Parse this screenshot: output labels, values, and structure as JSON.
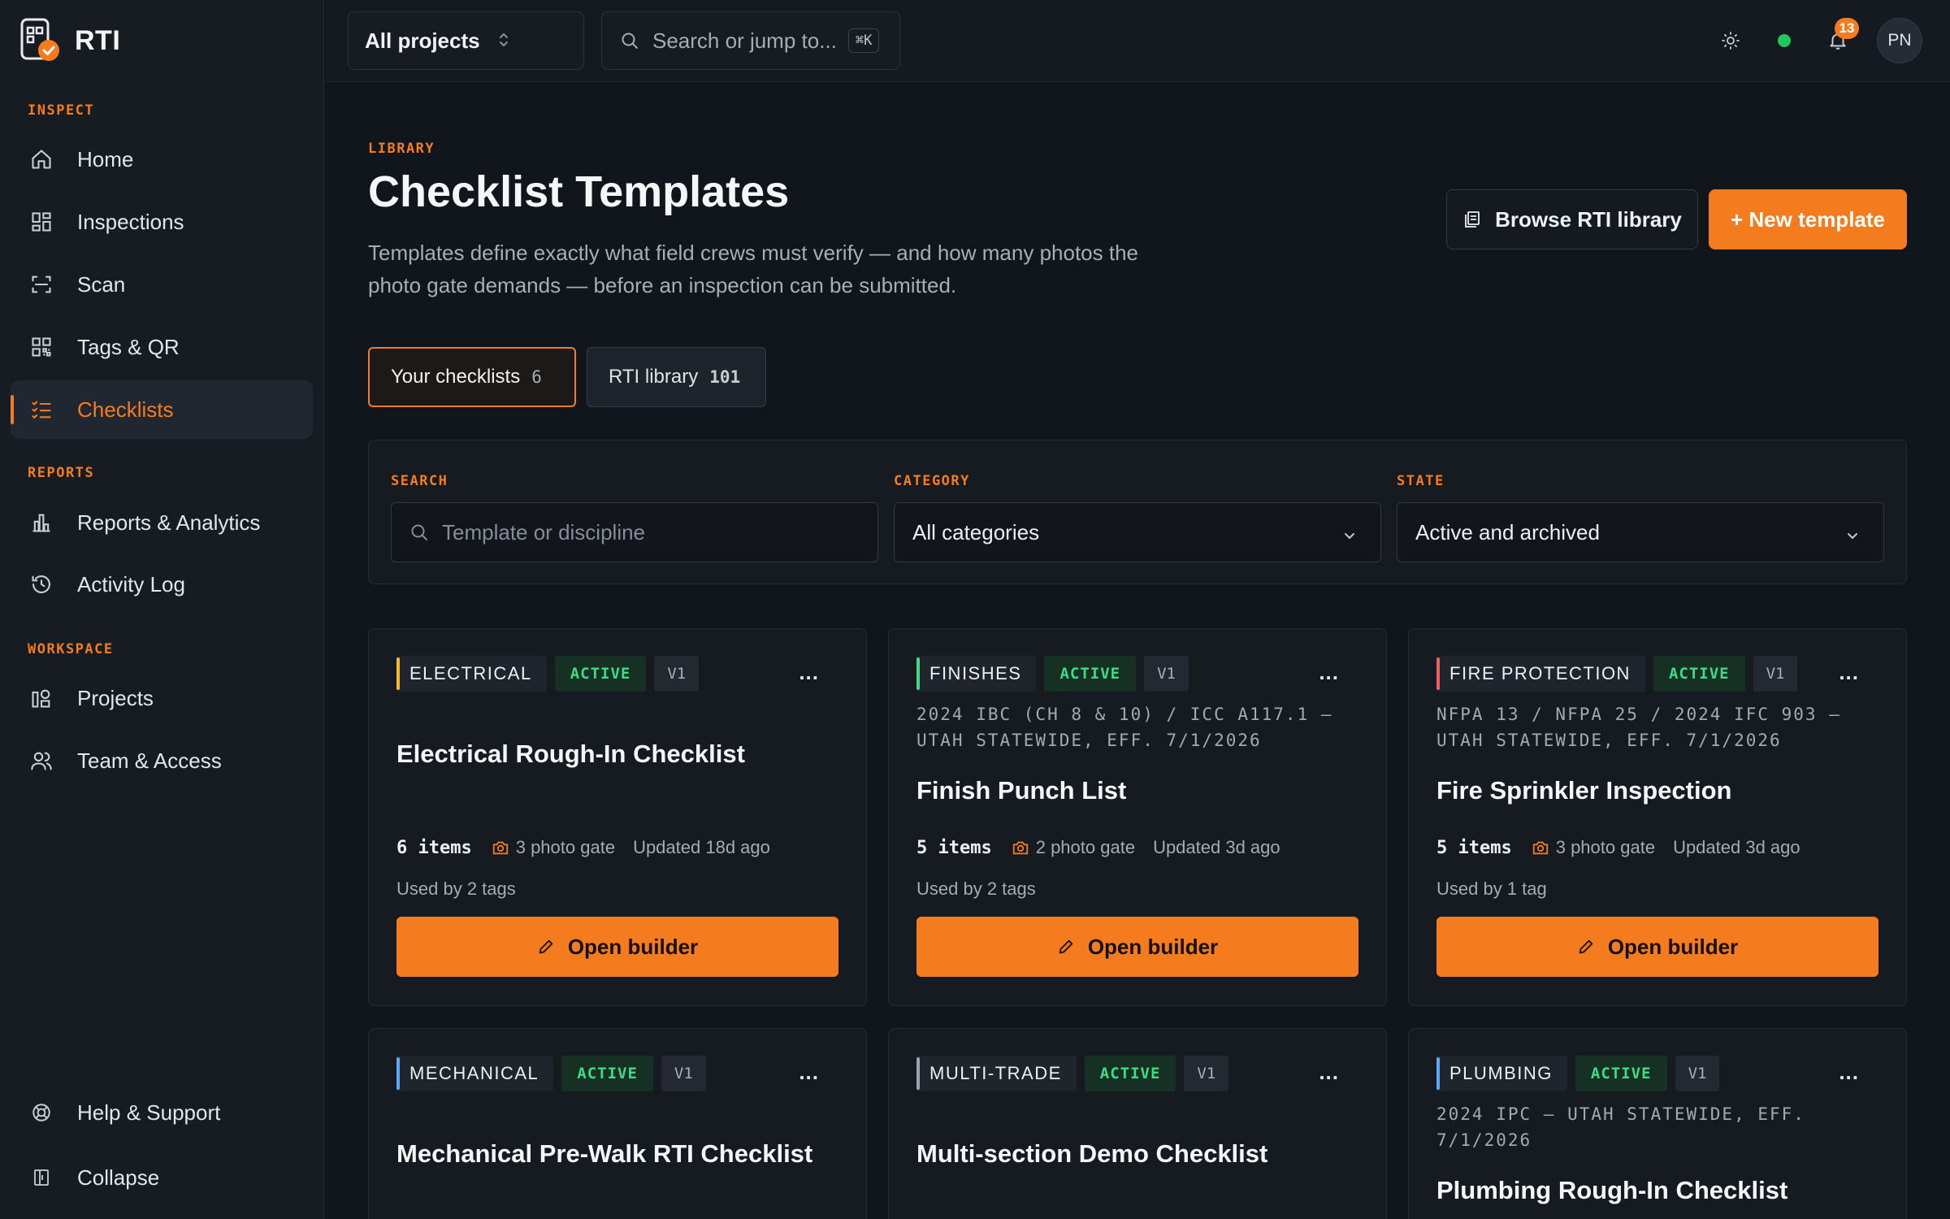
{
  "brand": {
    "name": "RTI"
  },
  "sidebar": {
    "sections": [
      {
        "label": "INSPECT"
      },
      {
        "label": "REPORTS"
      },
      {
        "label": "WORKSPACE"
      }
    ],
    "items": [
      {
        "label": "Home",
        "icon": "home-icon"
      },
      {
        "label": "Inspections",
        "icon": "grid-icon"
      },
      {
        "label": "Scan",
        "icon": "scan-icon"
      },
      {
        "label": "Tags & QR",
        "icon": "qr-icon"
      },
      {
        "label": "Checklists",
        "icon": "checklist-icon",
        "active": true
      },
      {
        "label": "Reports & Analytics",
        "icon": "bar-chart-icon"
      },
      {
        "label": "Activity Log",
        "icon": "history-icon"
      },
      {
        "label": "Projects",
        "icon": "projects-icon"
      },
      {
        "label": "Team & Access",
        "icon": "users-icon"
      }
    ],
    "bottom": [
      {
        "label": "Help & Support",
        "icon": "lifebuoy-icon"
      },
      {
        "label": "Collapse",
        "icon": "collapse-icon"
      }
    ]
  },
  "topbar": {
    "project_select": "All projects",
    "search_placeholder": "Search or jump to...",
    "search_shortcut": "⌘K",
    "notification_count": "13",
    "avatar_initials": "PN"
  },
  "page": {
    "eyebrow": "LIBRARY",
    "title": "Checklist Templates",
    "description": "Templates define exactly what field crews must verify — and how many photos the photo gate demands — before an inspection can be submitted.",
    "browse_button": "Browse RTI library",
    "new_button": "+ New template"
  },
  "tabs": [
    {
      "label": "Your checklists",
      "count": "6"
    },
    {
      "label": "RTI library",
      "count": "101"
    }
  ],
  "filters": {
    "search_label": "SEARCH",
    "search_placeholder": "Template or discipline",
    "category_label": "CATEGORY",
    "category_value": "All categories",
    "state_label": "STATE",
    "state_value": "Active and archived"
  },
  "cards": [
    {
      "category": "ELECTRICAL",
      "accent": "#f5b82e",
      "status": "ACTIVE",
      "version": "V1",
      "code": "",
      "title": "Electrical Rough-In Checklist",
      "items": "6 items",
      "photo_gate": "3 photo gate",
      "updated": "Updated 18d ago",
      "used_by": "Used by 2 tags",
      "button": "Open builder"
    },
    {
      "category": "FINISHES",
      "accent": "#3ddc84",
      "status": "ACTIVE",
      "version": "V1",
      "code": "2024 IBC (CH 8 & 10) / ICC A117.1 — UTAH STATEWIDE, EFF. 7/1/2026",
      "title": "Finish Punch List",
      "items": "5 items",
      "photo_gate": "2 photo gate",
      "updated": "Updated 3d ago",
      "used_by": "Used by 2 tags",
      "button": "Open builder"
    },
    {
      "category": "FIRE PROTECTION",
      "accent": "#f0605a",
      "status": "ACTIVE",
      "version": "V1",
      "code": "NFPA 13 / NFPA 25 / 2024 IFC 903 — UTAH STATEWIDE, EFF. 7/1/2026",
      "title": "Fire Sprinkler Inspection",
      "items": "5 items",
      "photo_gate": "3 photo gate",
      "updated": "Updated 3d ago",
      "used_by": "Used by 1 tag",
      "button": "Open builder"
    },
    {
      "category": "MECHANICAL",
      "accent": "#5aa9f5",
      "status": "ACTIVE",
      "version": "V1",
      "code": "",
      "title": "Mechanical Pre-Walk RTI Checklist"
    },
    {
      "category": "MULTI-TRADE",
      "accent": "#9aa3ae",
      "status": "ACTIVE",
      "version": "V1",
      "code": "",
      "title": "Multi-section Demo Checklist"
    },
    {
      "category": "PLUMBING",
      "accent": "#5aa9f5",
      "status": "ACTIVE",
      "version": "V1",
      "code": "2024 IPC — UTAH STATEWIDE, EFF. 7/1/2026",
      "title": "Plumbing Rough-In Checklist"
    }
  ],
  "card_more": "..."
}
